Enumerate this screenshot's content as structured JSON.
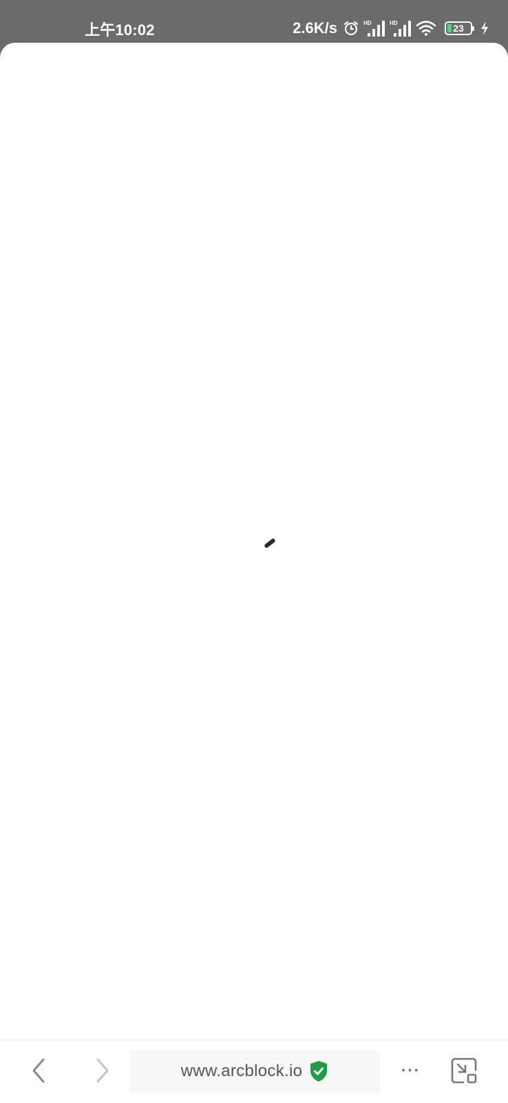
{
  "status_bar": {
    "time": "上午10:02",
    "net_speed": "2.6K/s",
    "signal_1_label": "HD",
    "signal_2_label": "HD",
    "battery_level": "23",
    "icons": [
      "alarm-icon",
      "signal-hd-icon",
      "signal-hd-icon",
      "wifi-icon",
      "battery-icon",
      "charging-icon"
    ]
  },
  "page": {
    "state": "loading"
  },
  "browser_bar": {
    "url": "www.arcblock.io",
    "secure": true,
    "more_label": "···",
    "icons": [
      "back-icon",
      "forward-icon",
      "secure-shield-icon",
      "more-icon",
      "exit-fullscreen-icon"
    ]
  },
  "colors": {
    "status_bar_bg": "#6b6b6b",
    "secure_shield": "#1a9f45",
    "battery_fill": "#3ddc84"
  }
}
